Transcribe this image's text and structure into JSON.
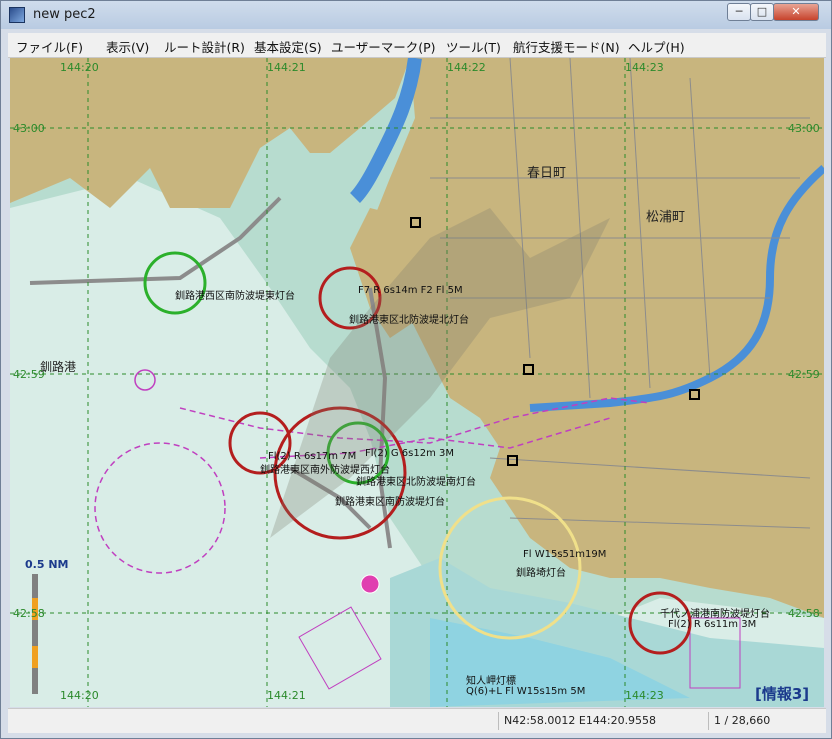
{
  "window": {
    "title": "new pec2",
    "controls": {
      "minimize": "─",
      "maximize": "□",
      "close": "✕"
    }
  },
  "menu": [
    "ファイル(F)",
    "表示(V)",
    "ルート設計(R)",
    "基本設定(S)",
    "ユーザーマーク(P)",
    "ツール(T)",
    "航行支援モード(N)",
    "ヘルプ(H)"
  ],
  "map": {
    "longitude_labels_top": [
      "144:20",
      "144:21",
      "144:22",
      "144:23"
    ],
    "longitude_labels_bottom": [
      "144:20",
      "144:21",
      "144:23"
    ],
    "latitude_labels": [
      "43:00",
      "42:59",
      "42:58"
    ],
    "place_names": {
      "kasuga": "春日町",
      "matsuura": "松浦町",
      "kushiro_port": "釧路港"
    },
    "light_labels": {
      "east_breakwater_label": "釧路港西区南防波堤東灯台",
      "north_light_char": "F7  R 6s14m F2 Fl 5M",
      "north_breakwater_label": "釧路港東区北防波堤北灯台",
      "south_west_char": "Fl(2) R 6s17m 7M",
      "center_char": "Fl(2) G 6s12m 3M",
      "south_west_label": "釧路港東区南外防波堤西灯台",
      "south_label": "釧路港東区北防波堤南灯台",
      "south_breakwater_label": "釧路港東区南防波堤灯台",
      "kushiro_saki_char": "Fl W15s51m19M",
      "kushiro_saki_label": "釧路埼灯台",
      "chiyo_label": "千代ノ浦港南防波堤灯台",
      "chiyo_char": "Fl(2) R 6s11m 3M",
      "bottom_light_label": "知人岬灯標",
      "bottom_light_char": "Q(6)+L Fl W15s15m 5M"
    },
    "scale_bar_label": "0.5 NM",
    "info_label": "[情報3]",
    "colors": {
      "land": "#c8b57e",
      "shallow": "#b7dccf",
      "deep": "#d9ede7",
      "river": "#4a8fd8",
      "light_red": "#b41e1e",
      "light_green": "#2bb02b",
      "light_yellow": "#f0e08a"
    }
  },
  "status": {
    "coordinates": "N42:58.0012 E144:20.9558",
    "scale": "1 / 28,660"
  }
}
